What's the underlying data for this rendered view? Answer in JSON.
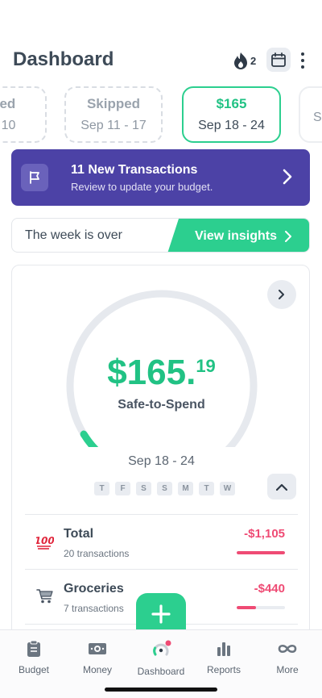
{
  "header": {
    "title": "Dashboard",
    "streak_count": "2"
  },
  "weeks": [
    {
      "label": "pped",
      "range": "4 - 10",
      "state": "skipped"
    },
    {
      "label": "Skipped",
      "range": "Sep 11 - 17",
      "state": "skipped"
    },
    {
      "label": "$165",
      "range": "Sep 18 - 24",
      "state": "active"
    },
    {
      "label": "",
      "range": "Se",
      "state": "next"
    }
  ],
  "transactions_banner": {
    "title": "11 New Transactions",
    "subtitle": "Review to update your budget."
  },
  "week_over": {
    "text": "The week is over",
    "button": "View insights"
  },
  "safe_to_spend": {
    "amount_main": "$165.",
    "amount_cents": "19",
    "label": "Safe-to-Spend",
    "range": "Sep 18 - 24",
    "progress": 0.08,
    "days": [
      "T",
      "F",
      "S",
      "S",
      "M",
      "T",
      "W"
    ]
  },
  "categories": [
    {
      "name": "Total",
      "count": "20 transactions",
      "value": "-$1,105",
      "fill": 1.0,
      "icon": "hundred-points-icon"
    },
    {
      "name": "Groceries",
      "count": "7 transactions",
      "value": "-$440",
      "fill": 0.4,
      "icon": "shopping-cart-icon"
    }
  ],
  "nav": {
    "items": [
      {
        "label": "Budget",
        "icon": "clipboard-icon"
      },
      {
        "label": "Money",
        "icon": "money-icon"
      },
      {
        "label": "Dashboard",
        "icon": "dashboard-gauge-icon"
      },
      {
        "label": "Reports",
        "icon": "bar-chart-icon"
      },
      {
        "label": "More",
        "icon": "infinity-icon"
      }
    ]
  },
  "colors": {
    "accent_green": "#2ccf8f",
    "banner_purple": "#4c42a6",
    "negative_red": "#ef4b74"
  }
}
